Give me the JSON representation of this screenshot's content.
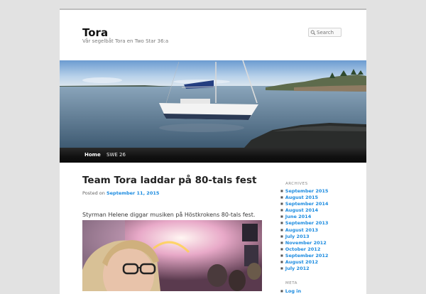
{
  "site": {
    "title": "Tora",
    "description": "Vår segelbåt Tora en Two Star 36:a",
    "search_placeholder": "Search"
  },
  "nav": {
    "items": [
      "Home",
      "SWE 26"
    ],
    "active": "Home"
  },
  "post": {
    "title": "Team Tora laddar på 80-tals fest",
    "meta_prefix": "Posted on",
    "date": "September 11, 2015",
    "text": "Styrman Helene diggar musiken på Höstkrokens 80-tals fest."
  },
  "sidebar": {
    "archives_title": "ARCHIVES",
    "archives": [
      "September 2015",
      "August 2015",
      "September 2014",
      "August 2014",
      "June 2014",
      "September 2013",
      "August 2013",
      "July 2013",
      "November 2012",
      "October 2012",
      "September 2012",
      "August 2012",
      "July 2012"
    ],
    "meta_title": "META",
    "meta": [
      "Log in"
    ]
  },
  "colors": {
    "link": "#1b8be0",
    "nav_bg": "#111111",
    "page_bg": "#e2e2e2"
  }
}
